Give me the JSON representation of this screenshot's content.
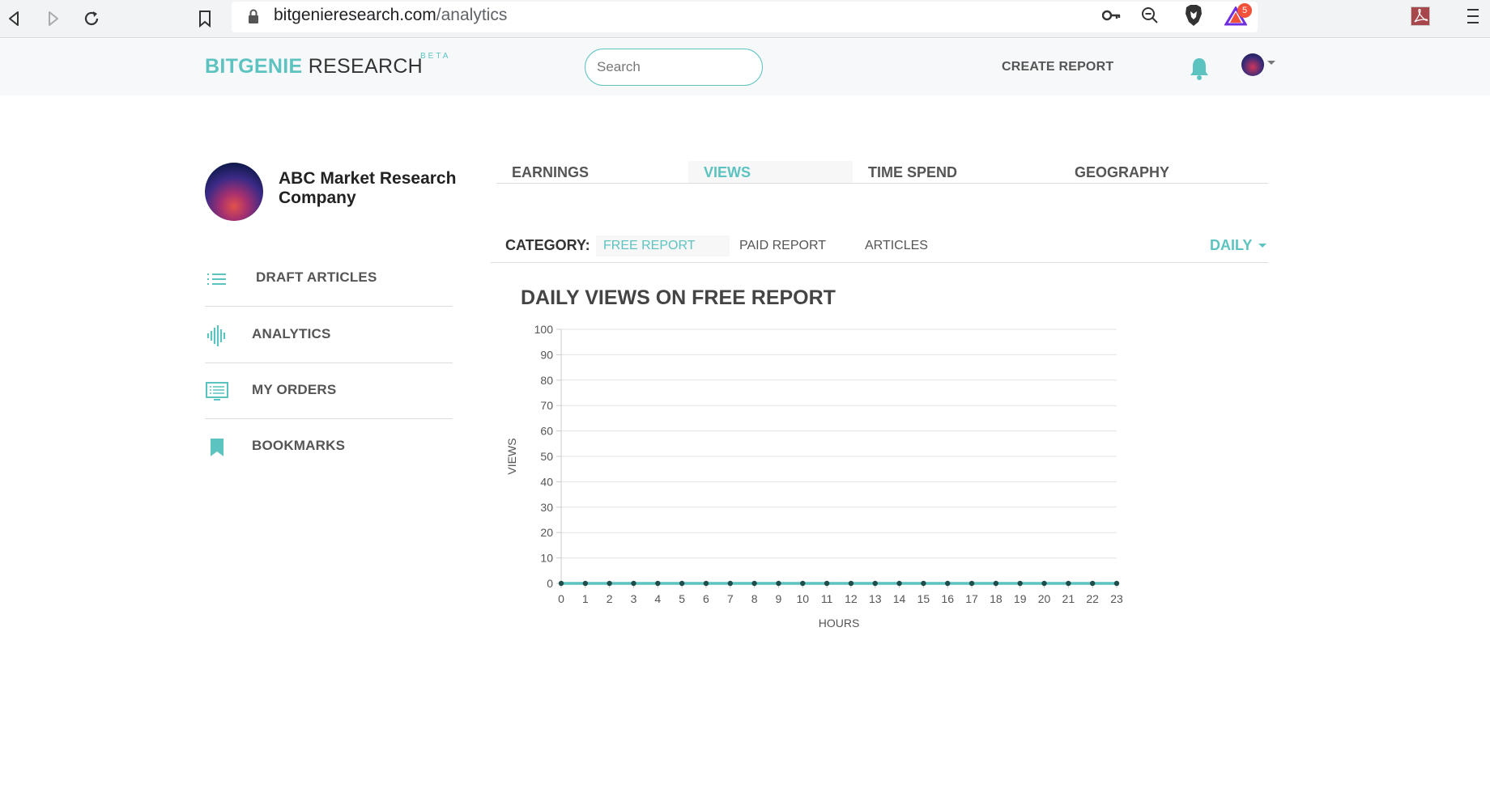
{
  "browser": {
    "url_domain": "bitgenieresearch.com",
    "url_path": "/analytics",
    "badge_count": "5"
  },
  "header": {
    "logo_brand": "BITGENIE",
    "logo_rest": " RESEARCH",
    "logo_beta": "BETA",
    "search_placeholder": "Search",
    "create_report": "CREATE REPORT"
  },
  "profile": {
    "name": "ABC Market Research Company"
  },
  "sidebar": {
    "items": [
      {
        "label": "DRAFT ARTICLES",
        "icon": "list-icon"
      },
      {
        "label": "ANALYTICS",
        "icon": "waveform-icon"
      },
      {
        "label": "MY ORDERS",
        "icon": "orders-icon"
      },
      {
        "label": "BOOKMARKS",
        "icon": "bookmark-icon"
      }
    ]
  },
  "tabs": [
    {
      "label": "EARNINGS"
    },
    {
      "label": "VIEWS"
    },
    {
      "label": "TIME SPEND"
    },
    {
      "label": "GEOGRAPHY"
    }
  ],
  "category": {
    "label": "CATEGORY:",
    "options": [
      "FREE REPORT",
      "PAID REPORT",
      "ARTICLES"
    ],
    "selected": "FREE REPORT",
    "period": "DAILY"
  },
  "colors": {
    "accent": "#5cc3c0",
    "marker": "#1f4d4c"
  },
  "chart_data": {
    "type": "line",
    "title": "DAILY VIEWS ON FREE REPORT",
    "xlabel": "HOURS",
    "ylabel": "VIEWS",
    "x": [
      0,
      1,
      2,
      3,
      4,
      5,
      6,
      7,
      8,
      9,
      10,
      11,
      12,
      13,
      14,
      15,
      16,
      17,
      18,
      19,
      20,
      21,
      22,
      23
    ],
    "values": [
      0,
      0,
      0,
      0,
      0,
      0,
      0,
      0,
      0,
      0,
      0,
      0,
      0,
      0,
      0,
      0,
      0,
      0,
      0,
      0,
      0,
      0,
      0,
      0
    ],
    "ylim": [
      0,
      100
    ],
    "yticks": [
      0,
      10,
      20,
      30,
      40,
      50,
      60,
      70,
      80,
      90,
      100
    ],
    "grid": true
  }
}
